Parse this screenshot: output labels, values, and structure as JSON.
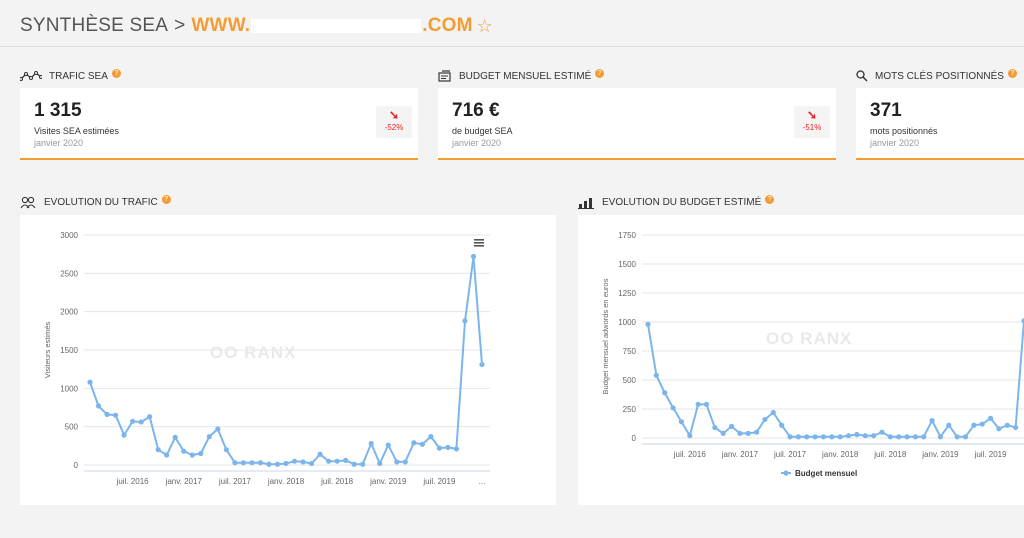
{
  "header": {
    "prefix": "SYNTHÈSE SEA",
    "separator": ">",
    "domain_start": "WWW.",
    "domain_end": ".COM",
    "star_icon": "star-icon"
  },
  "colors": {
    "accent": "#f39c34",
    "series": "#7cb5ec",
    "negative": "#e3262c"
  },
  "kpis": [
    {
      "label": "TRAFIC SEA",
      "value": "1 315",
      "desc": "Visites SEA estimées",
      "date": "janvier 2020",
      "change": "-52%",
      "icon": "trend-line-icon"
    },
    {
      "label": "BUDGET MENSUEL ESTIMÉ",
      "value": "716 €",
      "desc": "de budget SEA",
      "date": "janvier 2020",
      "change": "-51%",
      "icon": "budget-icon"
    },
    {
      "label": "MOTS CLÉS POSITIONNÉS",
      "value": "371",
      "desc": "mots positionnés",
      "date": "janvier 2020",
      "icon": "search-icon"
    }
  ],
  "sections": {
    "traffic": {
      "label": "EVOLUTION DU TRAFIC",
      "icon": "users-icon"
    },
    "budget": {
      "label": "EVOLUTION DU BUDGET ESTIMÉ",
      "icon": "chart-icon"
    }
  },
  "chart_data": [
    {
      "type": "line",
      "title": "",
      "xlabel": "",
      "ylabel": "Visiteurs estimés",
      "ylim": [
        0,
        3000
      ],
      "yticks": [
        0,
        500,
        1000,
        1500,
        2000,
        2500,
        3000
      ],
      "xtick_labels": [
        {
          "label": "juil. 2016",
          "index": 5
        },
        {
          "label": "janv. 2017",
          "index": 11
        },
        {
          "label": "juil. 2017",
          "index": 17
        },
        {
          "label": "janv. 2018",
          "index": 23
        },
        {
          "label": "juil. 2018",
          "index": 29
        },
        {
          "label": "janv. 2019",
          "index": 35
        },
        {
          "label": "juil. 2019",
          "index": 41
        },
        {
          "label": "...",
          "index": 46
        }
      ],
      "watermark": "OO RANX",
      "grid": true,
      "series": [
        {
          "values": [
            1080,
            770,
            660,
            650,
            390,
            570,
            560,
            630,
            200,
            130,
            360,
            180,
            130,
            150,
            370,
            470,
            200,
            30,
            30,
            30,
            30,
            10,
            10,
            20,
            50,
            40,
            20,
            140,
            50,
            50,
            60,
            10,
            10,
            280,
            20,
            260,
            40,
            40,
            290,
            270,
            370,
            220,
            230,
            210,
            1880,
            2720,
            1310
          ]
        }
      ]
    },
    {
      "type": "line",
      "title": "",
      "xlabel": "",
      "ylabel": "Budget mensuel adwords en euros",
      "ylim": [
        0,
        1750
      ],
      "yticks": [
        0,
        250,
        500,
        750,
        1000,
        1250,
        1500,
        1750
      ],
      "xtick_labels": [
        {
          "label": "juil. 2016",
          "index": 5
        },
        {
          "label": "janv. 2017",
          "index": 11
        },
        {
          "label": "juil. 2017",
          "index": 17
        },
        {
          "label": "janv. 2018",
          "index": 23
        },
        {
          "label": "juil. 2018",
          "index": 29
        },
        {
          "label": "janv. 2019",
          "index": 35
        },
        {
          "label": "juil. 2019",
          "index": 41
        }
      ],
      "watermark": "OO RANX",
      "grid": true,
      "legend": {
        "position": "bottom"
      },
      "series": [
        {
          "name": "Budget mensuel",
          "values": [
            980,
            540,
            390,
            260,
            140,
            20,
            290,
            290,
            90,
            40,
            100,
            40,
            40,
            50,
            160,
            220,
            110,
            10,
            10,
            10,
            10,
            10,
            10,
            10,
            20,
            30,
            20,
            20,
            50,
            10,
            10,
            10,
            10,
            10,
            150,
            10,
            110,
            10,
            10,
            110,
            120,
            170,
            80,
            110,
            90,
            1010
          ]
        }
      ]
    }
  ]
}
